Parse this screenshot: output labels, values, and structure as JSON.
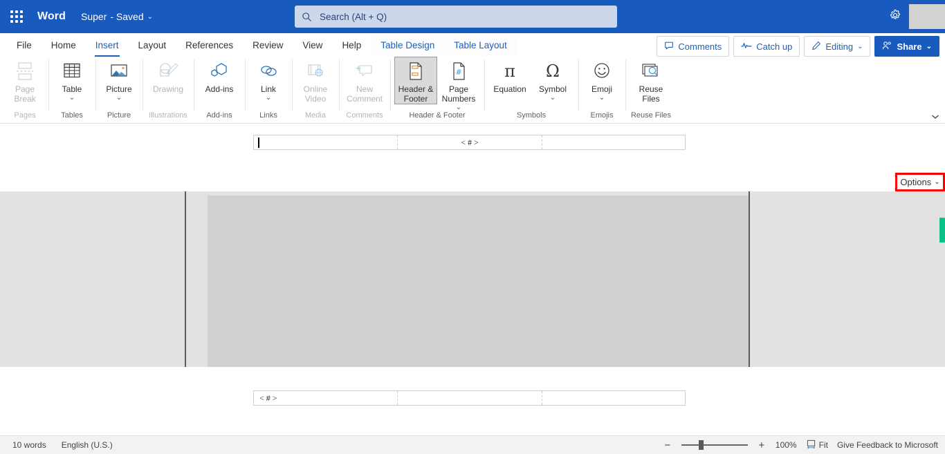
{
  "titlebar": {
    "app_grid_icon": "waffle-icon",
    "app_name": "Word",
    "document_name": "Super",
    "save_state": "- Saved",
    "title_chevron": "⌄",
    "settings_icon": "gear-icon",
    "search": {
      "icon": "search-icon",
      "placeholder": "Search (Alt + Q)",
      "value": ""
    },
    "brand_color": "#185ABD"
  },
  "tabs": [
    {
      "label": "File",
      "active": false,
      "contextual": false
    },
    {
      "label": "Home",
      "active": false,
      "contextual": false
    },
    {
      "label": "Insert",
      "active": true,
      "contextual": false
    },
    {
      "label": "Layout",
      "active": false,
      "contextual": false
    },
    {
      "label": "References",
      "active": false,
      "contextual": false
    },
    {
      "label": "Review",
      "active": false,
      "contextual": false
    },
    {
      "label": "View",
      "active": false,
      "contextual": false
    },
    {
      "label": "Help",
      "active": false,
      "contextual": false
    },
    {
      "label": "Table Design",
      "active": false,
      "contextual": true
    },
    {
      "label": "Table Layout",
      "active": false,
      "contextual": true
    }
  ],
  "tab_actions": {
    "comments": {
      "label": "Comments",
      "icon": "comment-icon"
    },
    "catch_up": {
      "label": "Catch up",
      "icon": "activity-icon"
    },
    "editing": {
      "label": "Editing",
      "icon": "pencil-icon",
      "chevron": "⌄"
    },
    "share": {
      "label": "Share",
      "icon": "share-person-icon",
      "chevron": "⌄"
    }
  },
  "ribbon": {
    "collapse_icon": "chevron-down-icon",
    "groups": [
      {
        "name": "Pages",
        "disabled": true,
        "items": [
          {
            "label": "Page\nBreak",
            "icon": "page-break-icon",
            "disabled": true,
            "chevron": "",
            "pressed": false
          }
        ]
      },
      {
        "name": "Tables",
        "disabled": false,
        "items": [
          {
            "label": "Table",
            "icon": "table-icon",
            "disabled": false,
            "chevron": "⌄",
            "pressed": false
          }
        ]
      },
      {
        "name": "Picture",
        "disabled": false,
        "items": [
          {
            "label": "Picture",
            "icon": "picture-icon",
            "disabled": false,
            "chevron": "⌄",
            "pressed": false
          }
        ]
      },
      {
        "name": "Illustrations",
        "disabled": true,
        "items": [
          {
            "label": "Drawing",
            "icon": "drawing-icon",
            "disabled": true,
            "chevron": "",
            "pressed": false
          }
        ]
      },
      {
        "name": "Add-ins",
        "disabled": false,
        "items": [
          {
            "label": "Add-ins",
            "icon": "add-ins-icon",
            "disabled": false,
            "chevron": "",
            "pressed": false
          }
        ]
      },
      {
        "name": "Links",
        "disabled": false,
        "items": [
          {
            "label": "Link",
            "icon": "link-icon",
            "disabled": false,
            "chevron": "⌄",
            "pressed": false
          }
        ]
      },
      {
        "name": "Media",
        "disabled": true,
        "items": [
          {
            "label": "Online\nVideo",
            "icon": "online-video-icon",
            "disabled": true,
            "chevron": "",
            "pressed": false
          }
        ]
      },
      {
        "name": "Comments",
        "disabled": true,
        "items": [
          {
            "label": "New\nComment",
            "icon": "new-comment-icon",
            "disabled": true,
            "chevron": "",
            "pressed": false
          }
        ]
      },
      {
        "name": "Header & Footer",
        "disabled": false,
        "items": [
          {
            "label": "Header &\nFooter",
            "icon": "header-footer-icon",
            "disabled": false,
            "chevron": "",
            "pressed": true
          },
          {
            "label": "Page\nNumbers",
            "icon": "page-numbers-icon",
            "disabled": false,
            "chevron": "⌄",
            "pressed": false
          }
        ]
      },
      {
        "name": "Symbols",
        "disabled": false,
        "items": [
          {
            "label": "Equation",
            "icon": "equation-pi-icon",
            "disabled": false,
            "chevron": "",
            "pressed": false
          },
          {
            "label": "Symbol",
            "icon": "symbol-omega-icon",
            "disabled": false,
            "chevron": "⌄",
            "pressed": false
          }
        ]
      },
      {
        "name": "Emojis",
        "disabled": false,
        "items": [
          {
            "label": "Emoji",
            "icon": "emoji-smiley-icon",
            "disabled": false,
            "chevron": "⌄",
            "pressed": false
          }
        ]
      },
      {
        "name": "Reuse Files",
        "disabled": false,
        "items": [
          {
            "label": "Reuse\nFiles",
            "icon": "reuse-files-icon",
            "disabled": false,
            "chevron": "",
            "pressed": false
          }
        ]
      }
    ]
  },
  "document": {
    "header_table": {
      "cells": [
        "",
        "< # >",
        ""
      ],
      "caret_in_cell": 0
    },
    "footer_table": {
      "cells": [
        "< # >",
        "",
        ""
      ]
    },
    "options_button": {
      "label": "Options",
      "chevron": "⌄",
      "highlight_color": "#ff0000"
    },
    "scrollbar": {
      "thumb_color": "#09c38b"
    }
  },
  "statusbar": {
    "word_count": "10 words",
    "language": "English (U.S.)",
    "zoom_out_icon": "minus-icon",
    "zoom_in_icon": "plus-icon",
    "zoom_level": "100%",
    "fit_label": "Fit",
    "fit_icon": "fit-page-icon",
    "feedback": "Give Feedback to Microsoft"
  }
}
